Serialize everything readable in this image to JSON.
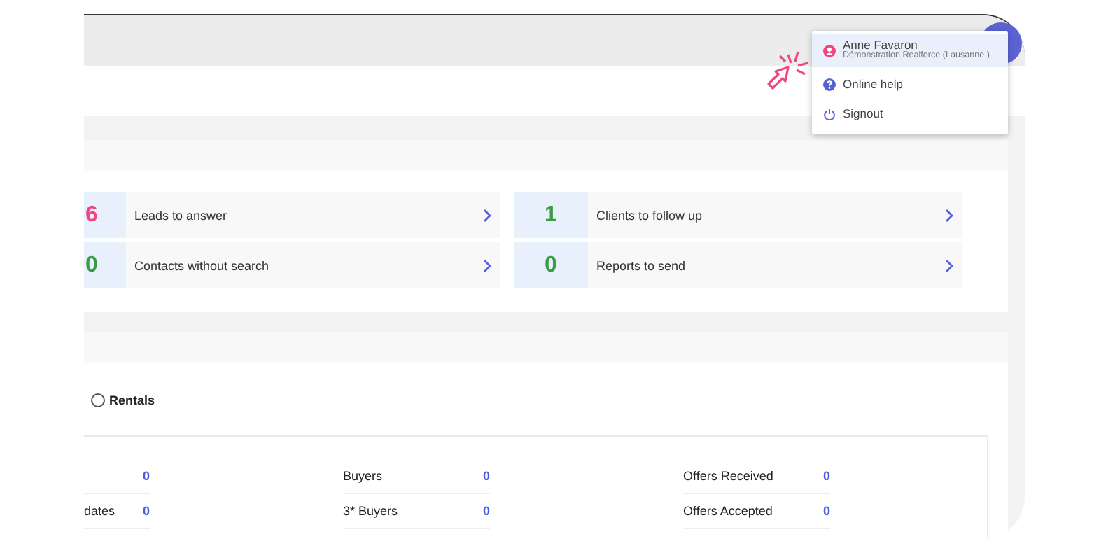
{
  "user_menu": {
    "items": [
      {
        "kind": "profile",
        "label": "Anne Favaron",
        "sublabel": "Démonstration Realforce (Lausanne )",
        "selected": true
      },
      {
        "kind": "help",
        "label": "Online help",
        "selected": false
      },
      {
        "kind": "signout",
        "label": "Signout",
        "selected": false
      }
    ]
  },
  "tasks": [
    {
      "count": "6",
      "label": "Leads to answer",
      "color": "#f0457f"
    },
    {
      "count": "1",
      "label": "Clients to follow up",
      "color": "#3a9d44"
    },
    {
      "count": "0",
      "label": "Contacts without search",
      "color": "#3a9d44"
    },
    {
      "count": "0",
      "label": "Reports to send",
      "color": "#3a9d44"
    }
  ],
  "filter": {
    "label": "Rentals",
    "checked": false
  },
  "stats": [
    {
      "rows": [
        {
          "value": "0"
        },
        {
          "label": "dates",
          "value": "0"
        }
      ]
    },
    {
      "rows": [
        {
          "label": "Buyers",
          "value": "0"
        },
        {
          "label": "3* Buyers",
          "value": "0"
        }
      ]
    },
    {
      "rows": [
        {
          "label": "Offers Received",
          "value": "0"
        },
        {
          "label": "Offers Accepted",
          "value": "0"
        }
      ]
    }
  ]
}
